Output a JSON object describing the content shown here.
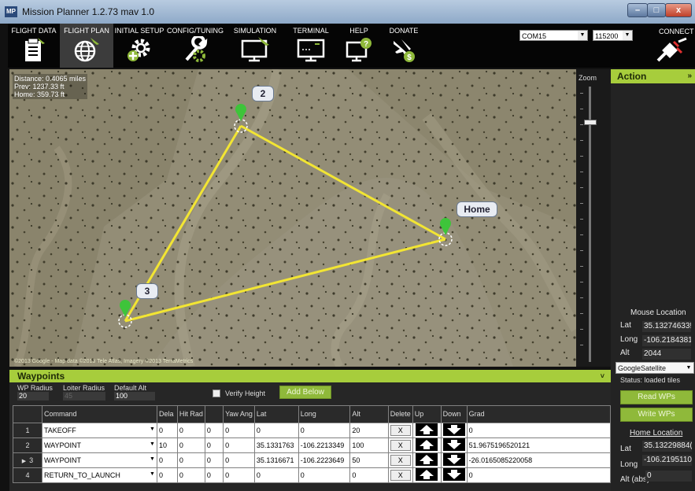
{
  "window": {
    "title": "Mission Planner 1.2.73 mav 1.0",
    "icon_text": "MP",
    "buttons": {
      "minimize": "–",
      "maximize": "□",
      "close": "x"
    }
  },
  "menu": {
    "items": [
      {
        "label": "FLIGHT DATA",
        "icon": "clipboard-plane-icon",
        "active": false
      },
      {
        "label": "FLIGHT PLAN",
        "icon": "globe-plane-icon",
        "active": true
      },
      {
        "label": "INITIAL SETUP",
        "icon": "gear-plus-icon",
        "active": false
      },
      {
        "label": "CONFIG/TUNING",
        "icon": "wrench-gear-icon",
        "active": false
      },
      {
        "label": "SIMULATION",
        "icon": "monitor-plane-icon",
        "active": false
      },
      {
        "label": "TERMINAL",
        "icon": "terminal-monitor-icon",
        "active": false
      },
      {
        "label": "HELP",
        "icon": "help-monitor-icon",
        "active": false
      },
      {
        "label": "DONATE",
        "icon": "plane-dollar-icon",
        "active": false
      }
    ],
    "port": "COM15",
    "baud": "115200",
    "connect_label": "CONNECT"
  },
  "map": {
    "distance": "Distance: 0.4065 miles",
    "prev": "Prev: 1237.33 ft",
    "home": "Home: 359.73 ft",
    "attribution": "©2013 Google - Map data ©2013 Tele Atlas, Imagery ©2013 TerraMetrics",
    "markers": [
      {
        "label": "2"
      },
      {
        "label": "Home"
      },
      {
        "label": "3"
      }
    ],
    "zoom_label": "Zoom"
  },
  "action_panel": {
    "title": "Action",
    "collapse": "»",
    "mouse_location_title": "Mouse Location",
    "lat_label": "Lat",
    "lat_value": "35.13274633!",
    "long_label": "Long",
    "long_value": "-106.2184381",
    "alt_label": "Alt",
    "alt_value": "2044",
    "map_type": "GoogleSatellite",
    "status": "Status: loaded tiles",
    "read_wps": "Read WPs",
    "write_wps": "Write WPs",
    "home_location_title": "Home Location",
    "home_lat_label": "Lat",
    "home_lat_value": "35.13229884(",
    "home_long_label": "Long",
    "home_long_value": "-106.2195110",
    "home_alt_label": "Alt (abs)",
    "home_alt_value": "0"
  },
  "waypoints": {
    "title": "Waypoints",
    "collapse": "˅",
    "wp_radius_label": "WP Radius",
    "wp_radius_value": "20",
    "loiter_radius_label": "Loiter Radius",
    "loiter_radius_value": "45",
    "default_alt_label": "Default Alt",
    "default_alt_value": "100",
    "verify_height_label": "Verify Height",
    "add_below_label": "Add Below",
    "columns": [
      "Command",
      "Dela",
      "Hit Rad",
      "",
      "Yaw Ang",
      "Lat",
      "Long",
      "Alt",
      "Delete",
      "Up",
      "Down",
      "Grad"
    ],
    "delete_label": "X",
    "rows": [
      {
        "num": "1",
        "selected": false,
        "command": "TAKEOFF",
        "p1": "0",
        "p2": "0",
        "p3": "0",
        "p4": "0",
        "lat": "0",
        "long": "0",
        "alt": "20",
        "grad": "0"
      },
      {
        "num": "2",
        "selected": false,
        "command": "WAYPOINT",
        "p1": "10",
        "p2": "0",
        "p3": "0",
        "p4": "0",
        "lat": "35.1331763",
        "long": "-106.2213349",
        "alt": "100",
        "grad": "51.9675196520121"
      },
      {
        "num": "3",
        "selected": true,
        "command": "WAYPOINT",
        "p1": "0",
        "p2": "0",
        "p3": "0",
        "p4": "0",
        "lat": "35.1316671",
        "long": "-106.2223649",
        "alt": "50",
        "grad": "-26.0165085220058"
      },
      {
        "num": "4",
        "selected": false,
        "command": "RETURN_TO_LAUNCH",
        "p1": "0",
        "p2": "0",
        "p3": "0",
        "p4": "0",
        "lat": "0",
        "long": "0",
        "alt": "0",
        "grad": "0"
      }
    ]
  },
  "colors": {
    "accent_green": "#a7cd3c",
    "route_yellow": "#f2e533",
    "marker_green": "#3ec43a"
  }
}
